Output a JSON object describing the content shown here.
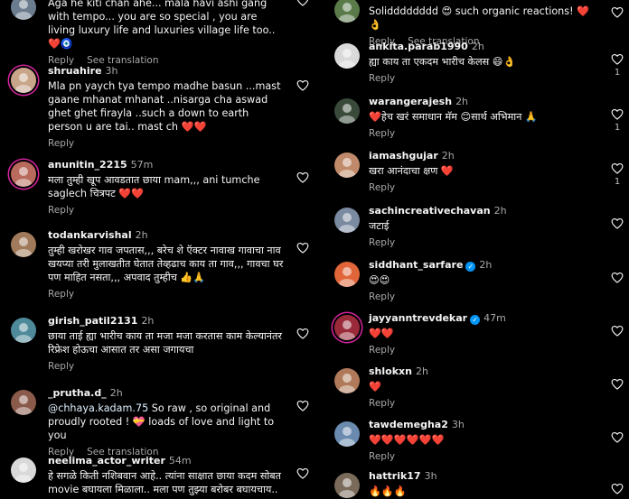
{
  "left_column": [
    {
      "username": "",
      "time": "",
      "text": "Aga he kiti chan ahe... mala havi ashi gang with tempo... you are so special , you are living luxury life and luxuries village life too.. ❤️🧿",
      "reply_label": "Reply",
      "translate_label": "See translation",
      "avatar_color": "#6b7c8f",
      "like_count": ""
    },
    {
      "username": "shruahire",
      "time": "3h",
      "text": "Mla pn yaych tya tempo madhe basun ...mast gaane mhanat mhanat ..nisarga cha aswad ghet ghet firayla ..such a down to earth person u are tai.. mast ch ❤️❤️",
      "reply_label": "Reply",
      "avatar_color": "#c9a58a",
      "like_count": ""
    },
    {
      "username": "anunitin_2215",
      "time": "57m",
      "text": "मला तुम्ही खूप आवडतात छाया mam,,, ani tumche saglech चित्रपट ❤️❤️",
      "reply_label": "Reply",
      "avatar_color": "#b86a5c",
      "like_count": ""
    },
    {
      "username": "todankarvishal",
      "time": "2h",
      "text": "तुम्ही खरोखर गाव जपतास,,, बरेच शे ऍक्टर नावाख गावाचा नाव खयप्या तरी मुलाखतीत घेतात तेव्हढाच काय ता गाव,,, गावचा घर पण माहित नसता,,, अपवाद तुम्हीच 👍🙏",
      "reply_label": "Reply",
      "avatar_color": "#a07a5a",
      "like_count": ""
    },
    {
      "username": "girish_patil2131",
      "time": "2h",
      "text": "छाया ताई ह्या भारीच काय ता मजा मजा करतास काम केल्यानंतर रिफ्रेश होऊचा आसात तर असा जगायचा",
      "reply_label": "Reply",
      "avatar_color": "#4f8a9a",
      "like_count": ""
    },
    {
      "username": "_prutha.d_",
      "time": "2h",
      "mention": "@chhaya.kadam.75",
      "text": " So raw , so original and proudly rooted ! 💝 loads of love and light to you",
      "reply_label": "Reply",
      "translate_label": "See translation",
      "avatar_color": "#8a5a4a",
      "like_count": ""
    },
    {
      "username": "neelima_actor_writer",
      "time": "54m",
      "text": "हे सगळे किती नशिबवान आहे.. त्यांना साक्षात छाया कदम सोबत movie बघायला मिळाला.. मला पण तुझ्या बरोबर बघायचाय..",
      "reply_label": "",
      "avatar_color": "#d9d9d9",
      "like_count": ""
    }
  ],
  "right_column": [
    {
      "username": "",
      "time": "",
      "text": "Solidddddddd 😍 such organic reactions! ❤️👌",
      "reply_label": "Reply",
      "translate_label": "See translation",
      "avatar_color": "#5a7a4a",
      "like_count": ""
    },
    {
      "username": "ankita.parab1990",
      "time": "2h",
      "text": "ह्या काय ता एकदम भारीच केलस 😄👌",
      "reply_label": "Reply",
      "avatar_color": "#d9d9d9",
      "like_count": "1"
    },
    {
      "username": "warangerajesh",
      "time": "2h",
      "text": "❤️हेच खरं समाधान मॅम 😊सार्थ अभिमान 🙏",
      "reply_label": "Reply",
      "avatar_color": "#3a4a3a",
      "like_count": "1"
    },
    {
      "username": "iamashgujar",
      "time": "2h",
      "text": "खरा आनंदाचा क्षण ❤️",
      "reply_label": "Reply",
      "avatar_color": "#c08a6a",
      "like_count": "1"
    },
    {
      "username": "sachincreativechavan",
      "time": "2h",
      "text": "जटाई",
      "reply_label": "Reply",
      "avatar_color": "#7a8aa0",
      "like_count": ""
    },
    {
      "username": "siddhant_sarfare",
      "time": "2h",
      "verified": true,
      "text": "😍😍",
      "reply_label": "Reply",
      "avatar_color": "#e0663a",
      "like_count": ""
    },
    {
      "username": "jayyanntrevdekar",
      "time": "47m",
      "verified": true,
      "text": "❤️❤️",
      "reply_label": "Reply",
      "avatar_color": "#9a2a3a",
      "like_count": ""
    },
    {
      "username": "shlokxn",
      "time": "2h",
      "text": "❤️",
      "reply_label": "Reply",
      "avatar_color": "#b07a5a",
      "like_count": ""
    },
    {
      "username": "tawdemegha2",
      "time": "3h",
      "text": "❤️❤️❤️❤️❤️❤️",
      "reply_label": "Reply",
      "avatar_color": "#6a8ab0",
      "like_count": ""
    },
    {
      "username": "hattrik17",
      "time": "3h",
      "text": "🔥🔥🔥",
      "reply_label": "",
      "avatar_color": "#7a6a5a",
      "like_count": ""
    }
  ]
}
